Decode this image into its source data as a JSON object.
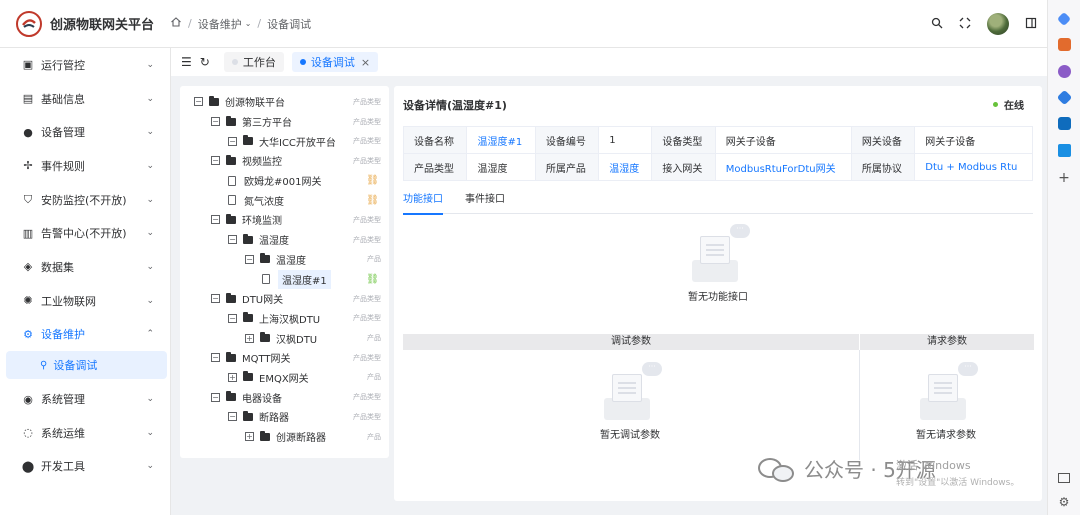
{
  "app": {
    "title": "创源物联网关平台"
  },
  "breadcrumb": [
    "设备维护",
    "设备调试"
  ],
  "sidebar": {
    "items": [
      {
        "label": "运行管控",
        "icon": "monitor-icon"
      },
      {
        "label": "基础信息",
        "icon": "info-card-icon"
      },
      {
        "label": "设备管理",
        "icon": "device-icon"
      },
      {
        "label": "事件规则",
        "icon": "rule-icon"
      },
      {
        "label": "安防监控(不开放)",
        "icon": "shield-icon"
      },
      {
        "label": "告警中心(不开放)",
        "icon": "alarm-icon"
      },
      {
        "label": "数据集",
        "icon": "layers-icon"
      },
      {
        "label": "工业物联网",
        "icon": "sun-icon"
      },
      {
        "label": "设备维护",
        "icon": "gear-icon"
      }
    ],
    "sub_active": "设备调试",
    "items_after": [
      {
        "label": "系统管理",
        "icon": "settings-icon"
      },
      {
        "label": "系统运维",
        "icon": "ops-icon"
      },
      {
        "label": "开发工具",
        "icon": "tool-icon"
      }
    ]
  },
  "tabs": [
    {
      "label": "工作台"
    },
    {
      "label": "设备调试"
    }
  ],
  "tree": [
    {
      "label": "创源物联平台",
      "tag": "产品类型",
      "level": 0,
      "type": "folder",
      "toggle": "−"
    },
    {
      "label": "第三方平台",
      "tag": "产品类型",
      "level": 1,
      "type": "folder",
      "toggle": "−"
    },
    {
      "label": "大华ICC开放平台",
      "tag": "产品类型",
      "level": 2,
      "type": "folder",
      "toggle": "−"
    },
    {
      "label": "视频监控",
      "tag": "产品类型",
      "level": 1,
      "type": "folder",
      "toggle": "−"
    },
    {
      "label": "欧姆龙#001网关",
      "tag": "",
      "level": 2,
      "type": "doc",
      "link": "broken"
    },
    {
      "label": "氮气浓度",
      "tag": "",
      "level": 2,
      "type": "doc",
      "link": "broken"
    },
    {
      "label": "环境监测",
      "tag": "产品类型",
      "level": 1,
      "type": "folder",
      "toggle": "−"
    },
    {
      "label": "温湿度",
      "tag": "产品类型",
      "level": 2,
      "type": "folder",
      "toggle": "−"
    },
    {
      "label": "温湿度",
      "tag": "产品",
      "level": 3,
      "type": "folder",
      "toggle": "−"
    },
    {
      "label": "温湿度#1",
      "tag": "",
      "level": 4,
      "type": "doc",
      "link": "ok",
      "selected": true
    },
    {
      "label": "DTU网关",
      "tag": "产品类型",
      "level": 1,
      "type": "folder",
      "toggle": "−"
    },
    {
      "label": "上海汉枫DTU",
      "tag": "产品类型",
      "level": 2,
      "type": "folder",
      "toggle": "−"
    },
    {
      "label": "汉枫DTU",
      "tag": "产品",
      "level": 3,
      "type": "folder",
      "toggle": "+"
    },
    {
      "label": "MQTT网关",
      "tag": "产品类型",
      "level": 1,
      "type": "folder",
      "toggle": "−"
    },
    {
      "label": "EMQX网关",
      "tag": "产品",
      "level": 2,
      "type": "folder",
      "toggle": "+"
    },
    {
      "label": "电器设备",
      "tag": "产品类型",
      "level": 1,
      "type": "folder",
      "toggle": "−"
    },
    {
      "label": "断路器",
      "tag": "产品类型",
      "level": 2,
      "type": "folder",
      "toggle": "−"
    },
    {
      "label": "创源断路器",
      "tag": "产品",
      "level": 3,
      "type": "folder",
      "toggle": "+"
    }
  ],
  "detail": {
    "title": "设备详情(温湿度#1)",
    "status": "在线",
    "status_color": "#67c23a",
    "rows": [
      [
        {
          "text": "设备名称",
          "kind": "k"
        },
        {
          "text": "温湿度#1",
          "kind": "blue"
        },
        {
          "text": "设备编号",
          "kind": "k"
        },
        {
          "text": "1",
          "kind": "v"
        },
        {
          "text": "设备类型",
          "kind": "k"
        },
        {
          "text": "网关子设备",
          "kind": "v"
        },
        {
          "text": "网关设备",
          "kind": "k"
        },
        {
          "text": "网关子设备",
          "kind": "v"
        }
      ],
      [
        {
          "text": "产品类型",
          "kind": "k"
        },
        {
          "text": "温湿度",
          "kind": "v"
        },
        {
          "text": "所属产品",
          "kind": "k"
        },
        {
          "text": "温湿度",
          "kind": "blue"
        },
        {
          "text": "接入网关",
          "kind": "k"
        },
        {
          "text": "ModbusRtuForDtu网关",
          "kind": "blue"
        },
        {
          "text": "所属协议",
          "kind": "k"
        },
        {
          "text": "Dtu + Modbus Rtu",
          "kind": "blue"
        }
      ]
    ],
    "tabs": [
      "功能接口",
      "事件接口"
    ],
    "empty_func": "暂无功能接口",
    "debug_params_title": "调试参数",
    "request_params_title": "请求参数",
    "empty_debug": "暂无调试参数",
    "empty_request": "暂无请求参数"
  },
  "watermark": {
    "text": "公众号 · 5开源",
    "activate": "激活 Windows",
    "activate_sub": "转到\"设置\"以激活 Windows。"
  },
  "colors": {
    "accent": "#1677ff",
    "brand": "#c0392b"
  }
}
